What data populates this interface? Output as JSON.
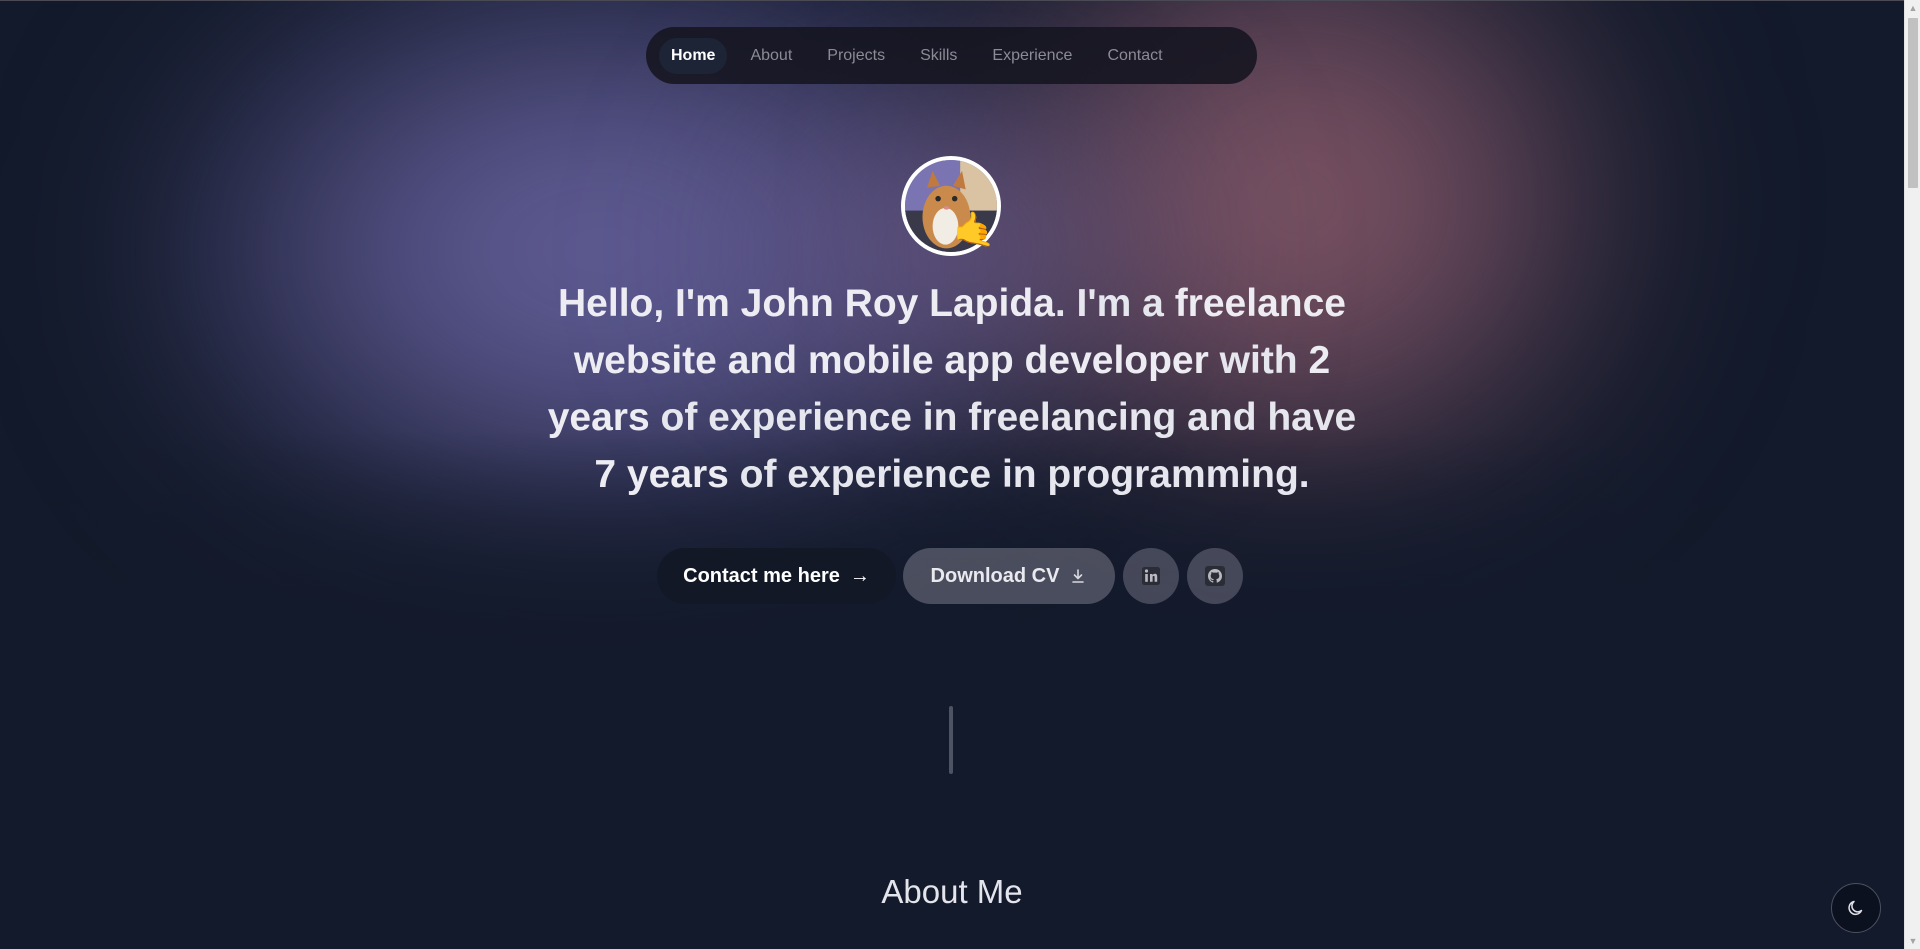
{
  "nav": {
    "items": [
      {
        "label": "Home",
        "active": true
      },
      {
        "label": "About",
        "active": false
      },
      {
        "label": "Projects",
        "active": false
      },
      {
        "label": "Skills",
        "active": false
      },
      {
        "label": "Experience",
        "active": false
      },
      {
        "label": "Contact",
        "active": false
      }
    ]
  },
  "hero": {
    "avatar_emoji": "🤙",
    "intro": {
      "p1_bold": "Hello, I'm John Roy Lapida",
      "p2": ". I'm a ",
      "p3_bold": "freelance website and mobile app developer",
      "p4": " with ",
      "p5_bold": "2 years",
      "p6": " of experience in freelancing and have ",
      "p7_bold": "7 years",
      "p8": " of experience in programming."
    }
  },
  "actions": {
    "contact_label": "Contact me here",
    "contact_arrow": "→",
    "cv_label": "Download CV",
    "linkedin_icon": "linkedin-icon",
    "github_icon": "github-icon"
  },
  "about": {
    "title": "About Me"
  },
  "theme_toggle": {
    "icon": "moon-icon"
  },
  "colors": {
    "background": "#131a2b",
    "accent_purple": "#706caa",
    "accent_rose": "#96606e",
    "button_dark": "#121826"
  }
}
